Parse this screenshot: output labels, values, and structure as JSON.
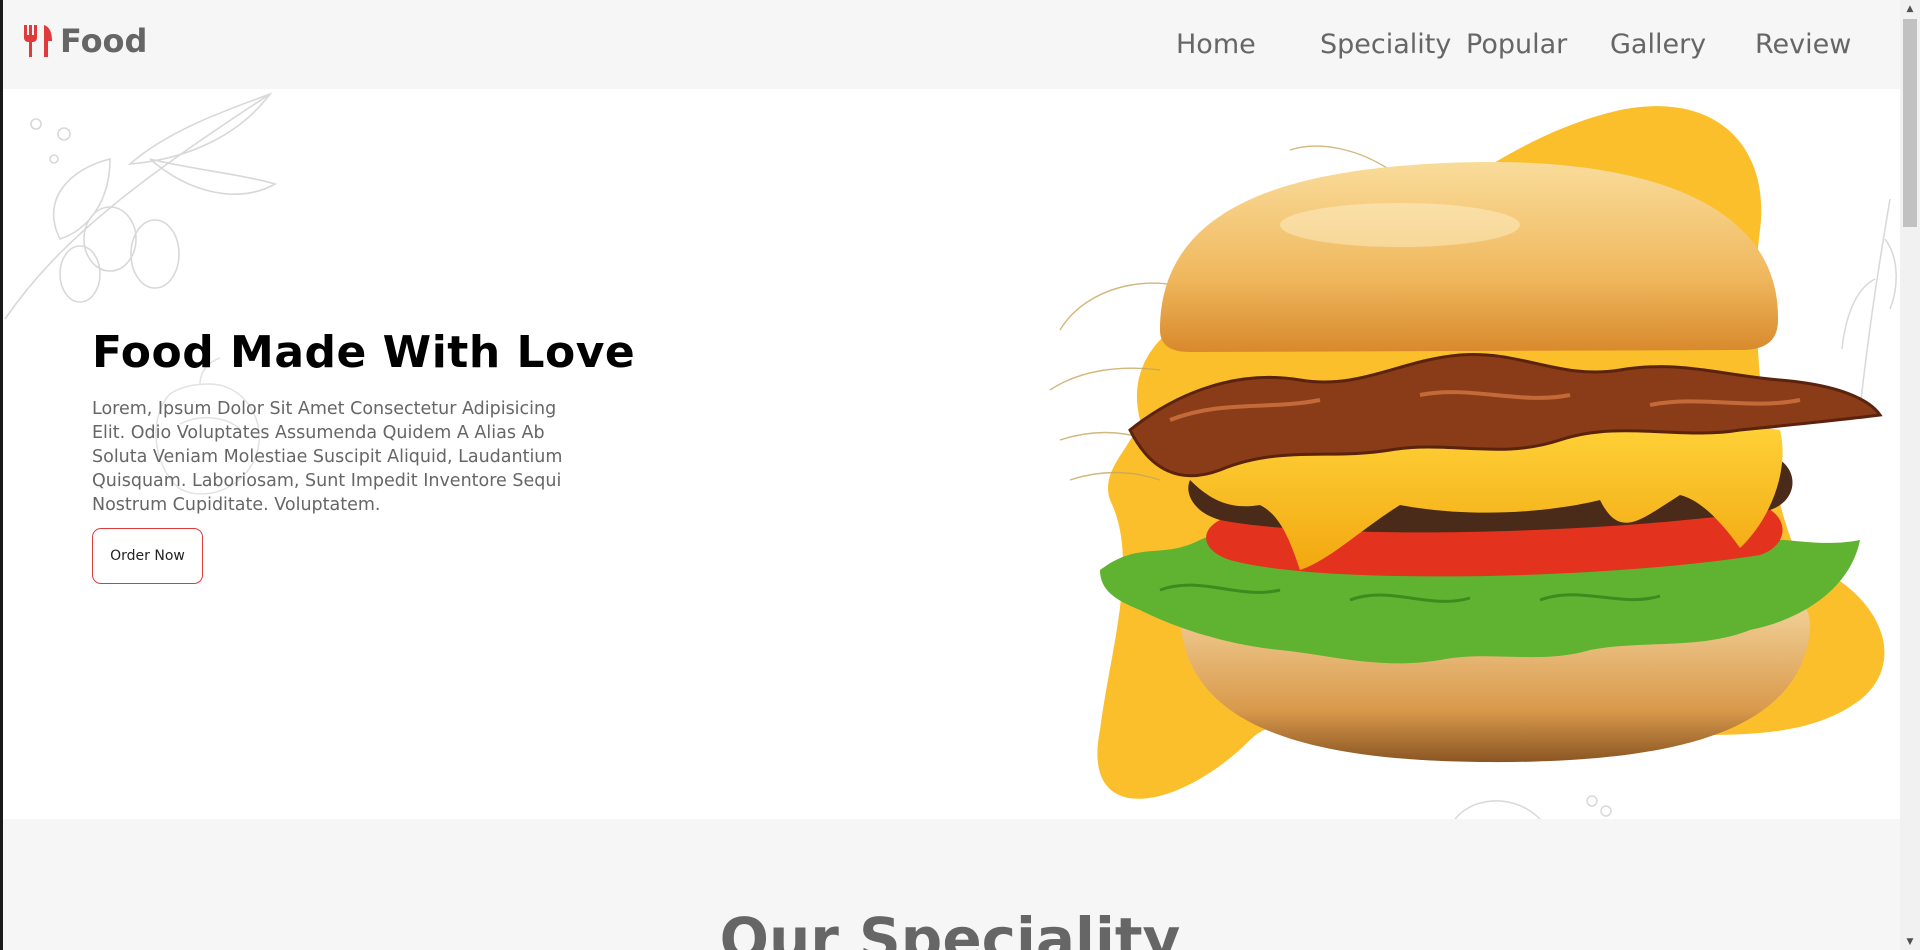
{
  "header": {
    "logo_text": "Food",
    "logo_icon": "fork-knife-icon",
    "nav": [
      {
        "label": "Home"
      },
      {
        "label": "Speciality"
      },
      {
        "label": "Popular"
      },
      {
        "label": "Gallery"
      },
      {
        "label": "Review"
      }
    ]
  },
  "hero": {
    "title": "Food Made With Love",
    "description": "Lorem, Ipsum Dolor Sit Amet Consectetur Adipisicing Elit. Odio Voluptates Assumenda Quidem A Alias Ab Soluta Veniam Molestiae Suscipit Aliquid, Laudantium Quisquam. Laboriosam, Sunt Impedit Inventore Sequi Nostrum Cupiditate. Voluptatem.",
    "button_label": "Order Now",
    "image_icon": "burger-icon"
  },
  "speciality": {
    "title": "Our Speciality"
  },
  "colors": {
    "accent": "#e03b3b",
    "blob": "#fbbf2c",
    "header_bg": "#f6f6f6",
    "text_muted": "#666666"
  }
}
